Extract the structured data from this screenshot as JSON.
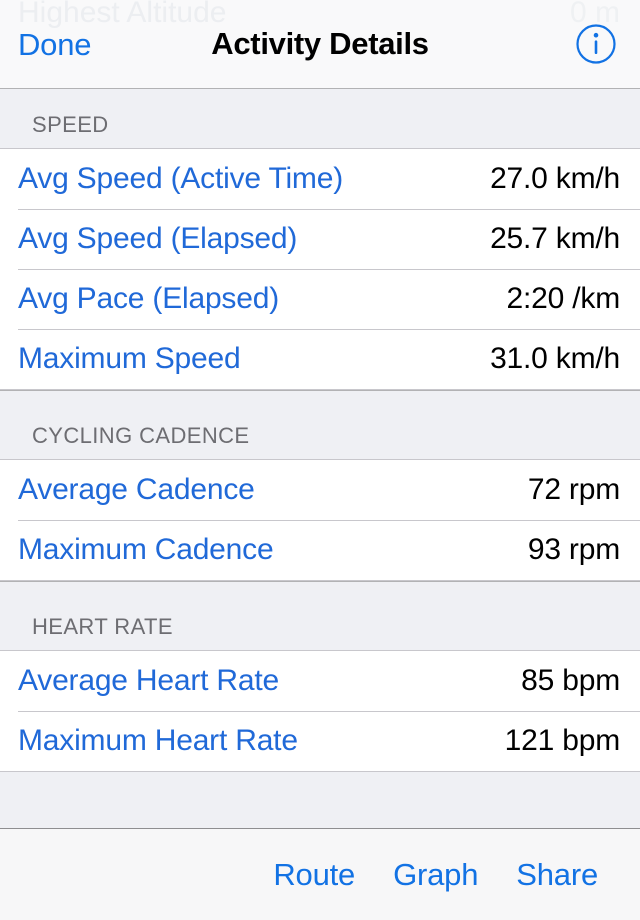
{
  "navbar": {
    "done_label": "Done",
    "title": "Activity Details",
    "info_icon": "info-circle-icon",
    "ghost_label": "Highest Altitude",
    "ghost_value": "0 m"
  },
  "sections": [
    {
      "header": "SPEED",
      "rows": [
        {
          "label": "Avg Speed (Active Time)",
          "value": "27.0 km/h"
        },
        {
          "label": "Avg Speed (Elapsed)",
          "value": "25.7 km/h"
        },
        {
          "label": "Avg Pace (Elapsed)",
          "value": "2:20 /km"
        },
        {
          "label": "Maximum Speed",
          "value": "31.0 km/h"
        }
      ]
    },
    {
      "header": "CYCLING CADENCE",
      "rows": [
        {
          "label": "Average Cadence",
          "value": "72 rpm"
        },
        {
          "label": "Maximum Cadence",
          "value": "93 rpm"
        }
      ]
    },
    {
      "header": "HEART RATE",
      "rows": [
        {
          "label": "Average Heart Rate",
          "value": "85 bpm"
        },
        {
          "label": "Maximum Heart Rate",
          "value": "121 bpm"
        }
      ]
    }
  ],
  "toolbar": {
    "buttons": [
      {
        "label": "Route"
      },
      {
        "label": "Graph"
      },
      {
        "label": "Share"
      }
    ]
  },
  "colors": {
    "accent_blue": "#1272e4",
    "row_label_blue": "#2069d8",
    "section_header_text": "#6d6d72",
    "section_background": "#eff0f4",
    "separator": "#c8c7cc",
    "toolbar_background": "#f7f7f8"
  }
}
